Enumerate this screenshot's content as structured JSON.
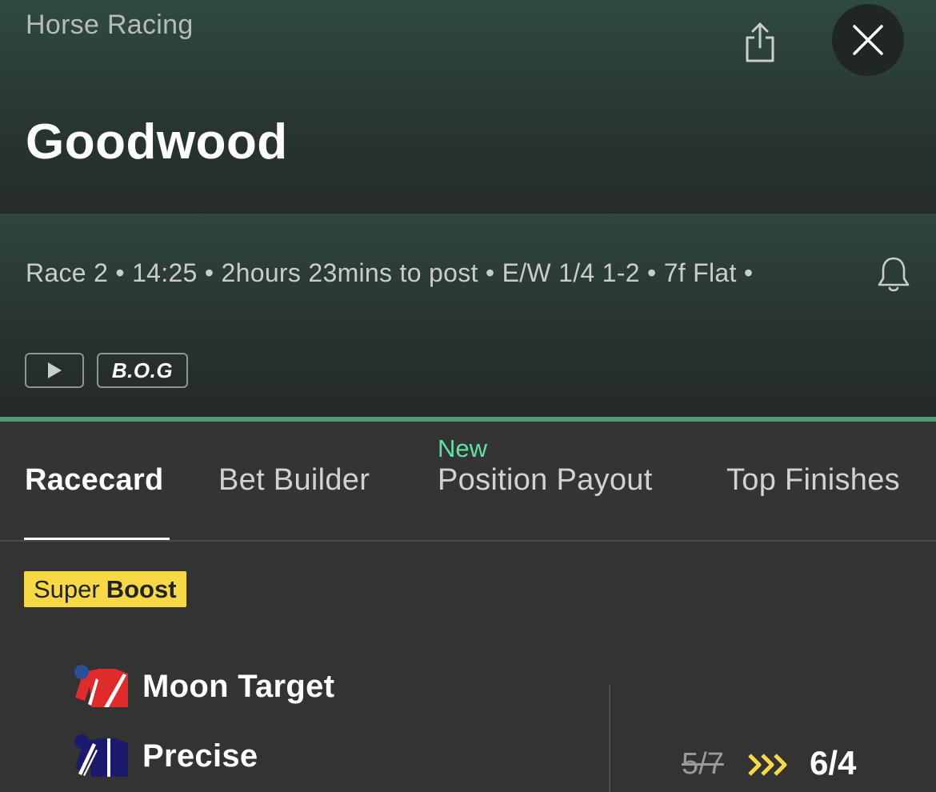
{
  "header": {
    "breadcrumb": "Horse Racing",
    "title": "Goodwood",
    "share_icon": "share-icon",
    "close_icon": "close-icon"
  },
  "race_info": {
    "meta": "Race 2 • 14:25 • 2hours 23mins to post • E/W 1/4 1-2 • 7f Flat •",
    "bell_icon": "bell-icon",
    "play_icon": "play-icon",
    "bog_label": "B.O.G"
  },
  "tabs": {
    "items": [
      {
        "label": "Racecard",
        "active": true
      },
      {
        "label": "Bet Builder",
        "active": false
      },
      {
        "label": "Position Payout",
        "active": false,
        "badge": "New"
      },
      {
        "label": "Top Finishes",
        "active": false
      }
    ]
  },
  "boost": {
    "label_prefix": "Super",
    "label_bold": "Boost",
    "runners": [
      {
        "name": "Moon Target",
        "silk_icon": "silk-red-white-diagonal-icon"
      },
      {
        "name": "Precise",
        "silk_icon": "silk-navy-white-stripe-icon"
      }
    ],
    "old_odds": "5/7",
    "new_odds": "6/4",
    "arrows_icon": "boost-arrows-icon"
  },
  "colors": {
    "accent_green": "#4e9a7a",
    "new_badge": "#5ee3a6",
    "boost_yellow": "#f6d944",
    "background": "#333333"
  }
}
